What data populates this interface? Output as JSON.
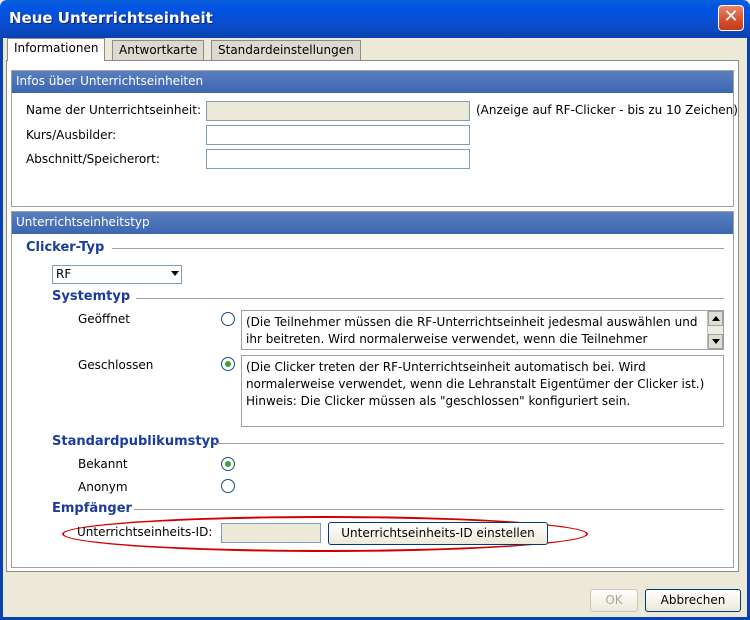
{
  "window": {
    "title": "Neue Unterrichtseinheit",
    "accent": "#0054e3"
  },
  "tabs": [
    {
      "label": "Informationen",
      "active": true
    },
    {
      "label": "Antwortkarte",
      "active": false
    },
    {
      "label": "Standardeinstellungen",
      "active": false
    }
  ],
  "info": {
    "header": "Infos über Unterrichtseinheiten",
    "name_label": "Name der Unterrichtseinheit:",
    "name_value": "",
    "name_hint": "(Anzeige auf RF-Clicker - bis zu 10 Zeichen)",
    "course_label": "Kurs/Ausbilder:",
    "course_value": "",
    "section_label": "Abschnitt/Speicherort:",
    "section_value": ""
  },
  "type": {
    "header": "Unterrichtseinheitstyp",
    "clicker_type_title": "Clicker-Typ",
    "clicker_selected": "RF",
    "system_type_title": "Systemtyp",
    "open_label": "Geöffnet",
    "open_desc": "(Die Teilnehmer müssen die RF-Unterrichtseinheit jedesmal auswählen und ihr beitreten. Wird normalerweise verwendet, wenn die Teilnehmer",
    "closed_label": "Geschlossen",
    "closed_desc": "(Die Clicker treten der RF-Unterrichtseinheit automatisch bei. Wird normalerweise verwendet, wenn die Lehranstalt Eigentümer der Clicker ist.) Hinweis: Die Clicker müssen als \"geschlossen\" konfiguriert sein.",
    "audience_title": "Standardpublikumstyp",
    "known_label": "Bekannt",
    "anon_label": "Anonym",
    "receiver_title": "Empfänger",
    "unit_id_label": "Unterrichtseinheits-ID:",
    "unit_id_value": "",
    "set_id_button": "Unterrichtseinheits-ID einstellen",
    "highlight_color": "#d40000"
  },
  "footer": {
    "ok_label": "OK",
    "cancel_label": "Abbrechen"
  }
}
